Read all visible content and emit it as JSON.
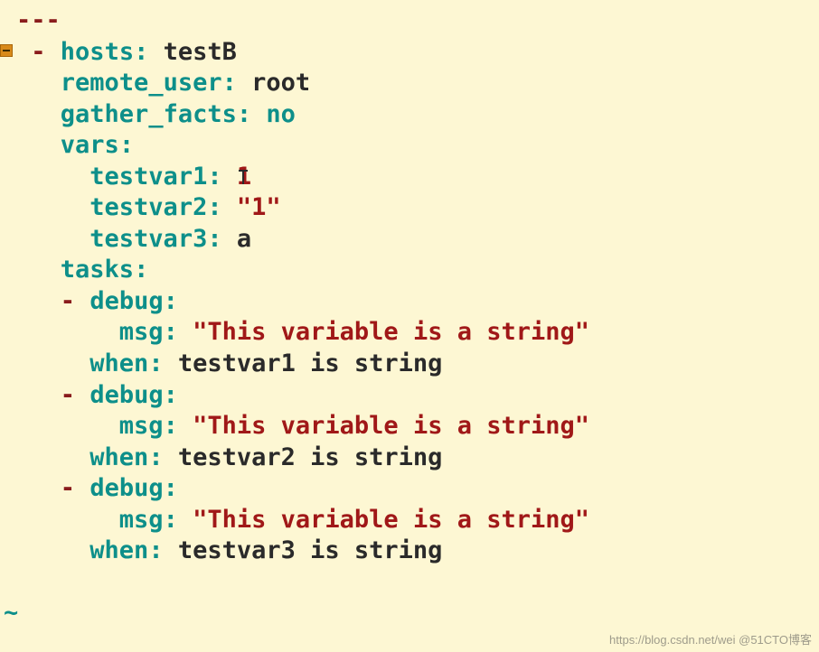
{
  "doc_start": "---",
  "hosts_key": "hosts",
  "hosts_val": "testB",
  "remote_user_key": "remote_user",
  "remote_user_val": "root",
  "gather_facts_key": "gather_facts",
  "gather_facts_val": "no",
  "vars_key": "vars",
  "vars": {
    "testvar1_key": "testvar1",
    "testvar1_val": "1",
    "testvar2_key": "testvar2",
    "testvar2_val": "\"1\"",
    "testvar3_key": "testvar3",
    "testvar3_val": "a"
  },
  "tasks_key": "tasks",
  "tasks": [
    {
      "module_key": "debug",
      "msg_key": "msg",
      "msg_val": "\"This variable is a string\"",
      "when_key": "when",
      "when_val": "testvar1 is string"
    },
    {
      "module_key": "debug",
      "msg_key": "msg",
      "msg_val": "\"This variable is a string\"",
      "when_key": "when",
      "when_val": "testvar2 is string"
    },
    {
      "module_key": "debug",
      "msg_key": "msg",
      "msg_val": "\"This variable is a string\"",
      "when_key": "when",
      "when_val": "testvar3 is string"
    }
  ],
  "watermark": "https://blog.csdn.net/wei @51CTO博客"
}
